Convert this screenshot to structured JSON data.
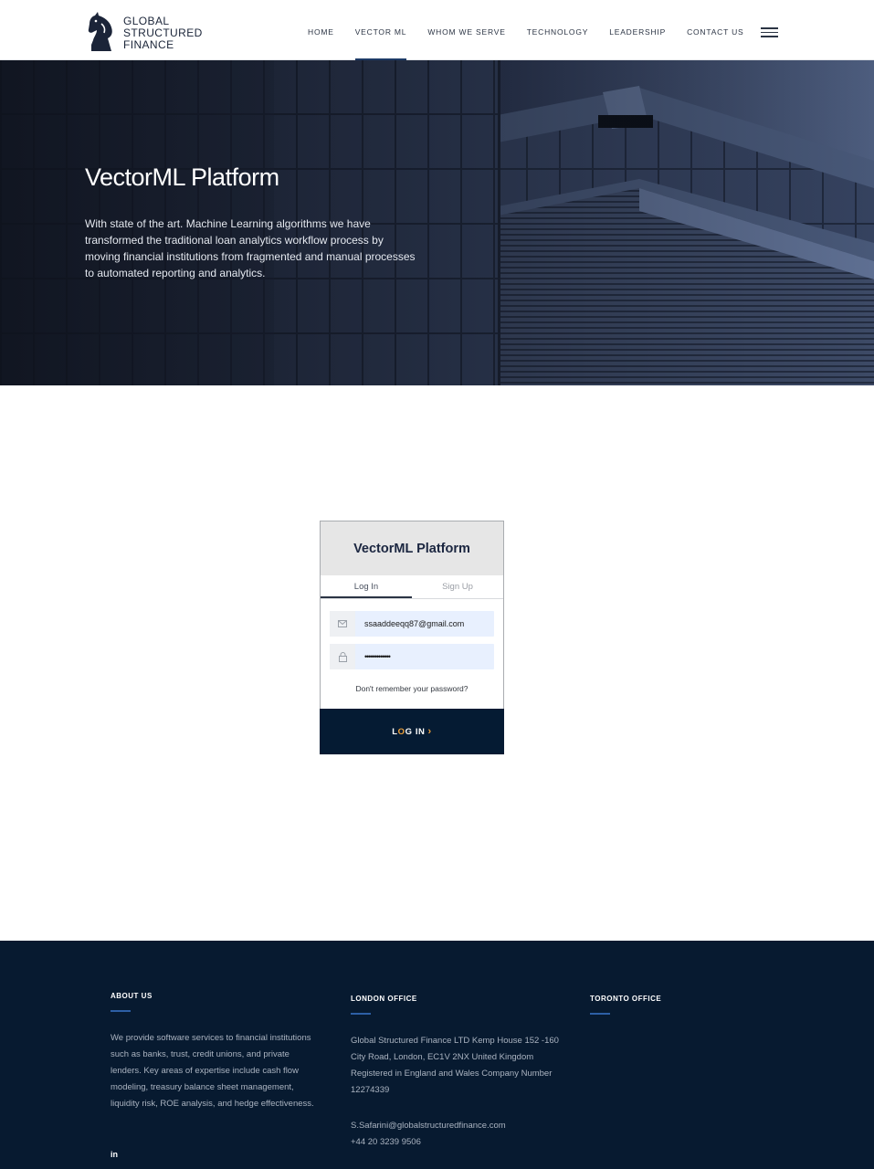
{
  "header": {
    "logo_lines": [
      "GLOBAL",
      "STRUCTURED",
      "FINANCE"
    ],
    "nav": [
      "HOME",
      "VECTOR ML",
      "WHOM WE SERVE",
      "TECHNOLOGY",
      "LEADERSHIP",
      "CONTACT US"
    ],
    "active_nav": "VECTOR ML"
  },
  "hero": {
    "title": "VectorML Platform",
    "description": "With state of the art. Machine Learning algorithms we have transformed the traditional loan analytics workflow process by moving financial institutions from fragmented and manual processes to automated reporting and analytics."
  },
  "login": {
    "title": "VectorML Platform",
    "tabs": [
      "Log In",
      "Sign Up"
    ],
    "active_tab": "Log In",
    "email_value": "ssaaddeeqq87@gmail.com",
    "password_value": "•••••••••••••",
    "forgot": "Don't remember your password?",
    "button_text_1": "L",
    "button_text_2": "G IN",
    "button_accent_char": "O",
    "button_chevron": "›",
    "email_icon": "envelope-icon",
    "password_icon": "lock-icon"
  },
  "footer": {
    "about": {
      "heading": "ABOUT US",
      "text": "We provide software services to financial institutions such as banks, trust, credit unions, and private lenders. Key areas of expertise include cash flow modeling, treasury balance sheet management, liquidity risk, ROE analysis, and hedge effectiveness."
    },
    "london": {
      "heading": "LONDON OFFICE",
      "address": "Global Structured Finance LTD Kemp House 152 -160 City Road, London, EC1V 2NX United Kingdom Registered in England and Wales Company Number 12274339",
      "email": "S.Safarini@globalstructuredfinance.com",
      "phone": "+44 20 3239 9506"
    },
    "toronto": {
      "heading": "TORONTO OFFICE"
    },
    "social": "in"
  },
  "colors": {
    "navy": "#051b33",
    "footer_bg": "#071a30",
    "accent": "#f0a23a",
    "nav_underline": "#1d3a66"
  }
}
